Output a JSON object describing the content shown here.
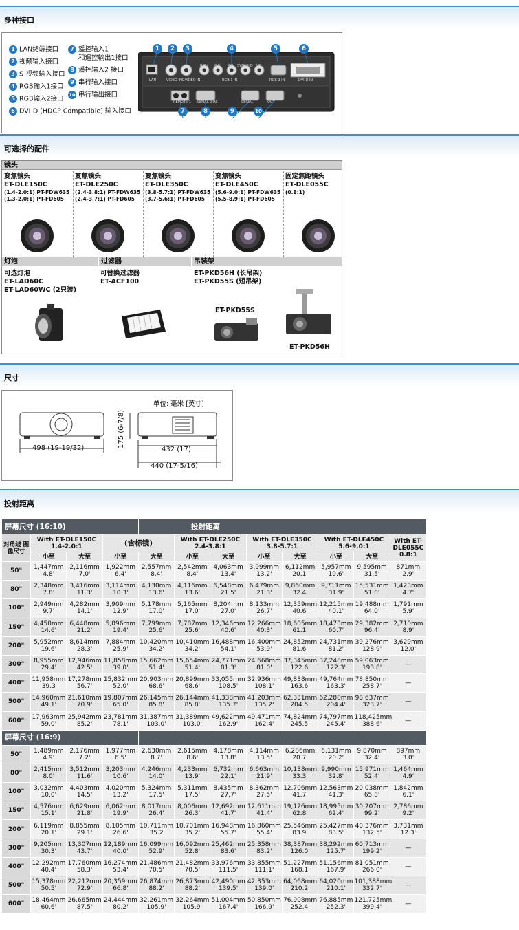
{
  "sections": {
    "ports": "多种接口",
    "accessories": "可选择的配件",
    "dimensions": "尺寸",
    "throw": "投射距离"
  },
  "ports": {
    "left": [
      {
        "n": "1",
        "label": "LAN终端接口"
      },
      {
        "n": "2",
        "label": "视频输入接口"
      },
      {
        "n": "3",
        "label": "S-视频输入接口"
      },
      {
        "n": "4",
        "label": "RGB输入1接口"
      },
      {
        "n": "5",
        "label": "RGB输入2接口"
      },
      {
        "n": "6",
        "label": "DVI-D (HDCP Compatible) 输入接口"
      }
    ],
    "right": [
      {
        "n": "7",
        "label": "遥控输入1",
        "label2": "和遥控输出1接口"
      },
      {
        "n": "8",
        "label": "遥控输入2 接口"
      },
      {
        "n": "9",
        "label": "串行输入接口"
      },
      {
        "n": "10",
        "label": "串行输出接口"
      }
    ],
    "panel_labels": {
      "lan": "LAN",
      "video_in": "VIDEO IN",
      "s_video_in": "S-VIDEO IN",
      "rgb1_in": "RGB 1 IN",
      "rgb2_in": "RGB 2 IN",
      "dvi_d_in": "DVI-D IN",
      "remote1": "REMOTE 1",
      "serial2_in": "SERIAL 2 IN",
      "serial": "SERIAL",
      "out": "OUT",
      "b_pb": "B/Pb",
      "g_y": "G/Y",
      "r_pr": "R/Pr",
      "sync_hd": "SYNC/HD",
      "vd": "VD"
    }
  },
  "accessories": {
    "lens_header": "镜头",
    "lenses": [
      {
        "type": "变焦镜头",
        "model": "ET-DLE150C",
        "l1": "(1.4-2.0:1) PT-FDW635",
        "l2": "(1.3-2.0:1) PT-FD605"
      },
      {
        "type": "变焦镜头",
        "model": "ET-DLE250C",
        "l1": "(2.4-3.8:1) PT-FDW635",
        "l2": "(2.4-3.7:1) PT-FD605"
      },
      {
        "type": "变焦镜头",
        "model": "ET-DLE350C",
        "l1": "(3.8-5.7:1) PT-FDW635",
        "l2": "(3.7-5.6:1) PT-FD605"
      },
      {
        "type": "变焦镜头",
        "model": "ET-DLE450C",
        "l1": "(5.6-9.0:1) PT-FDW635",
        "l2": "(5.5-8.9:1) PT-FD605"
      },
      {
        "type": "固定焦距镜头",
        "model": "ET-DLE055C",
        "l1": "(0.8:1)",
        "l2": ""
      }
    ],
    "lamp": {
      "header": "灯泡",
      "l1": "可选灯泡",
      "l2": "ET-LAD60C",
      "l3": "ET-LAD60WC (2只装)"
    },
    "filter": {
      "header": "过滤器",
      "l1": "可替换过滤器",
      "l2": "ET-ACF100"
    },
    "mount": {
      "header": "吊装架",
      "l1": "ET-PKD56H (长吊架)",
      "l2": "ET-PKD55S (短吊架)",
      "img1": "ET-PKD55S",
      "img2": "ET-PKD56H"
    }
  },
  "dimensions": {
    "unit": "单位: 毫米 [英寸]",
    "width": "498 (19-19/32)",
    "height": "175 (6-7/8)",
    "depth1": "432 (17)",
    "depth2": "440 (17-5/16)"
  },
  "throw": {
    "title_left": "屏幕尺寸 (16:10)",
    "title_right": "投射距离",
    "title_169": "屏幕尺寸 (16:9)",
    "diag_label": "对角线 图像尺寸",
    "lens_headers": [
      {
        "l1": "With ET-DLE150C",
        "l2": "1.4-2.0:1"
      },
      {
        "l1": "(含标镜)",
        "l2": ""
      },
      {
        "l1": "With ET-DLE250C",
        "l2": "2.4-3.8:1"
      },
      {
        "l1": "With ET-DLE350C",
        "l2": "3.8-5.7:1"
      },
      {
        "l1": "With ET-DLE450C",
        "l2": "5.6-9.0:1"
      },
      {
        "l1": "With ET-DLE055C",
        "l2": "0.8:1"
      }
    ],
    "min_label": "小至",
    "max_label": "大至",
    "rows_1610": [
      {
        "size": "50\"",
        "cells": [
          [
            "1,447mm",
            "4.8'"
          ],
          [
            "2,116mm",
            "7.0'"
          ],
          [
            "1,922mm",
            "6.4'"
          ],
          [
            "2,557mm",
            "8.4'"
          ],
          [
            "2,542mm",
            "8.4'"
          ],
          [
            "4,063mm",
            "13.4'"
          ],
          [
            "3,999mm",
            "13.2'"
          ],
          [
            "6,112mm",
            "20.1'"
          ],
          [
            "5,957mm",
            "19.6'"
          ],
          [
            "9,595mm",
            "31.5'"
          ],
          [
            "871mm",
            "2.9'"
          ]
        ]
      },
      {
        "size": "80\"",
        "cells": [
          [
            "2,348mm",
            "7.8'"
          ],
          [
            "3,416mm",
            "11.3'"
          ],
          [
            "3,114mm",
            "10.3'"
          ],
          [
            "4,130mm",
            "13.6'"
          ],
          [
            "4,116mm",
            "13.6'"
          ],
          [
            "6,548mm",
            "21.5'"
          ],
          [
            "6,479mm",
            "21.3'"
          ],
          [
            "9,860mm",
            "32.4'"
          ],
          [
            "9,711mm",
            "31.9'"
          ],
          [
            "15,531mm",
            "51.0'"
          ],
          [
            "1,423mm",
            "4.7'"
          ]
        ]
      },
      {
        "size": "100\"",
        "cells": [
          [
            "2,949mm",
            "9.7'"
          ],
          [
            "4,282mm",
            "14.1'"
          ],
          [
            "3,909mm",
            "12.9'"
          ],
          [
            "5,178mm",
            "17.0'"
          ],
          [
            "5,165mm",
            "17.0'"
          ],
          [
            "8,204mm",
            "27.0'"
          ],
          [
            "8,133mm",
            "26.7'"
          ],
          [
            "12,359mm",
            "40.6'"
          ],
          [
            "12,215mm",
            "40.1'"
          ],
          [
            "19,488mm",
            "64.0'"
          ],
          [
            "1,791mm",
            "5.9'"
          ]
        ]
      },
      {
        "size": "150\"",
        "cells": [
          [
            "4,450mm",
            "14.6'"
          ],
          [
            "6,448mm",
            "21.2'"
          ],
          [
            "5,896mm",
            "19.4'"
          ],
          [
            "7,799mm",
            "25.6'"
          ],
          [
            "7,787mm",
            "25.6'"
          ],
          [
            "12,346mm",
            "40.6'"
          ],
          [
            "12,266mm",
            "40.3'"
          ],
          [
            "18,605mm",
            "61.1'"
          ],
          [
            "18,473mm",
            "60.7'"
          ],
          [
            "29,382mm",
            "96.4'"
          ],
          [
            "2,710mm",
            "8.9'"
          ]
        ]
      },
      {
        "size": "200\"",
        "cells": [
          [
            "5,952mm",
            "19.6'"
          ],
          [
            "8,614mm",
            "28.3'"
          ],
          [
            "7,884mm",
            "25.9'"
          ],
          [
            "10,420mm",
            "34.2'"
          ],
          [
            "10,410mm",
            "34.2'"
          ],
          [
            "16,488mm",
            "54.1'"
          ],
          [
            "16,400mm",
            "53.9'"
          ],
          [
            "24,852mm",
            "81.6'"
          ],
          [
            "24,731mm",
            "81.2'"
          ],
          [
            "39,276mm",
            "128.9'"
          ],
          [
            "3,629mm",
            "12.0'"
          ]
        ]
      },
      {
        "size": "300\"",
        "cells": [
          [
            "8,955mm",
            "29.4'"
          ],
          [
            "12,946mm",
            "42.5'"
          ],
          [
            "11,858mm",
            "39.0'"
          ],
          [
            "15,662mm",
            "51.4'"
          ],
          [
            "15,654mm",
            "51.4'"
          ],
          [
            "24,771mm",
            "81.3'"
          ],
          [
            "24,668mm",
            "81.0'"
          ],
          [
            "37,345mm",
            "122.6'"
          ],
          [
            "37,248mm",
            "122.3'"
          ],
          [
            "59,063mm",
            "193.8'"
          ],
          [
            "—",
            ""
          ]
        ]
      },
      {
        "size": "400\"",
        "cells": [
          [
            "11,958mm",
            "39.3"
          ],
          [
            "17,278mm",
            "56.7'"
          ],
          [
            "15,832mm",
            "52.0'"
          ],
          [
            "20,903mm",
            "68.6'"
          ],
          [
            "20,899mm",
            "68.6'"
          ],
          [
            "33,055mm",
            "108.5'"
          ],
          [
            "32,936mm",
            "108.1'"
          ],
          [
            "49,838mm",
            "163.6'"
          ],
          [
            "49,764mm",
            "163.3'"
          ],
          [
            "78,850mm",
            "258.7'"
          ],
          [
            "—",
            ""
          ]
        ]
      },
      {
        "size": "500\"",
        "cells": [
          [
            "14,960mm",
            "49.1'"
          ],
          [
            "21,610mm",
            "70.9'"
          ],
          [
            "19,807mm",
            "65.0'"
          ],
          [
            "26,145mm",
            "85.8'"
          ],
          [
            "26,144mm",
            "85.8'"
          ],
          [
            "41,338mm",
            "135.7'"
          ],
          [
            "41,203mm",
            "135.2'"
          ],
          [
            "62,331mm",
            "204.5'"
          ],
          [
            "62,280mm",
            "204.4'"
          ],
          [
            "98,637mm",
            "323.7'"
          ],
          [
            "—",
            ""
          ]
        ]
      },
      {
        "size": "600\"",
        "cells": [
          [
            "17,963mm",
            "59.0'"
          ],
          [
            "25,942mm",
            "85.2'"
          ],
          [
            "23,781mm",
            "78.1'"
          ],
          [
            "31,387mm",
            "103.0'"
          ],
          [
            "31,389mm",
            "103.0'"
          ],
          [
            "49,622mm",
            "162.9'"
          ],
          [
            "49,471mm",
            "162.4'"
          ],
          [
            "74,824mm",
            "245.5'"
          ],
          [
            "74,797mm",
            "245.4'"
          ],
          [
            "118,425mm",
            "388.6'"
          ],
          [
            "—",
            ""
          ]
        ]
      }
    ],
    "rows_169": [
      {
        "size": "50\"",
        "cells": [
          [
            "1,489mm",
            "4.9'"
          ],
          [
            "2,176mm",
            "7.2'"
          ],
          [
            "1,977mm",
            "6.5'"
          ],
          [
            "2,630mm",
            "8.7'"
          ],
          [
            "2,615mm",
            "8.6'"
          ],
          [
            "4,178mm",
            "13.8'"
          ],
          [
            "4,114mm",
            "13.5'"
          ],
          [
            "6,286mm",
            "20.7'"
          ],
          [
            "6,131mm",
            "20.2'"
          ],
          [
            "9,870mm",
            "32.4'"
          ],
          [
            "897mm",
            "3.0'"
          ]
        ]
      },
      {
        "size": "80\"",
        "cells": [
          [
            "2,415mm",
            "8.0'"
          ],
          [
            "3,512mm",
            "11.6'"
          ],
          [
            "3,203mm",
            "10.6'"
          ],
          [
            "4,246mm",
            "14.0'"
          ],
          [
            "4,233mm",
            "13.9'"
          ],
          [
            "6,732mm",
            "22.1'"
          ],
          [
            "6,663mm",
            "21.9'"
          ],
          [
            "10,138mm",
            "33.3'"
          ],
          [
            "9,990mm",
            "32.8'"
          ],
          [
            "15,971mm",
            "52.4'"
          ],
          [
            "1,464mm",
            "4.9'"
          ]
        ]
      },
      {
        "size": "100\"",
        "cells": [
          [
            "3,032mm",
            "10.0'"
          ],
          [
            "4,403mm",
            "14.5'"
          ],
          [
            "4,020mm",
            "13.2'"
          ],
          [
            "5,324mm",
            "17.5'"
          ],
          [
            "5,311mm",
            "17.5'"
          ],
          [
            "8,435mm",
            "27.7'"
          ],
          [
            "8,362mm",
            "27.5'"
          ],
          [
            "12,706mm",
            "41.7'"
          ],
          [
            "12,563mm",
            "41.3'"
          ],
          [
            "20,038mm",
            "65.8'"
          ],
          [
            "1,842mm",
            "6.1'"
          ]
        ]
      },
      {
        "size": "150\"",
        "cells": [
          [
            "4,576mm",
            "15.1'"
          ],
          [
            "6,629mm",
            "21.8'"
          ],
          [
            "6,062mm",
            "19.9'"
          ],
          [
            "8,017mm",
            "26.4'"
          ],
          [
            "8,006mm",
            "26.3'"
          ],
          [
            "12,692mm",
            "41.7'"
          ],
          [
            "12,611mm",
            "41.4'"
          ],
          [
            "19,126mm",
            "62.8'"
          ],
          [
            "18,995mm",
            "62.4'"
          ],
          [
            "30,207mm",
            "99.2'"
          ],
          [
            "2,786mm",
            "9.2'"
          ]
        ]
      },
      {
        "size": "200\"",
        "cells": [
          [
            "6,119mm",
            "20.1'"
          ],
          [
            "8,855mm",
            "29.1'"
          ],
          [
            "8,105mm",
            "26.6'"
          ],
          [
            "10,711mm",
            "35.2"
          ],
          [
            "10,701mm",
            "35.2'"
          ],
          [
            "16,948mm",
            "55.7'"
          ],
          [
            "16,860mm",
            "55.4'"
          ],
          [
            "25,546mm",
            "83.9'"
          ],
          [
            "25,427mm",
            "83.5'"
          ],
          [
            "40,376mm",
            "132.5'"
          ],
          [
            "3,731mm",
            "12.3'"
          ]
        ]
      },
      {
        "size": "300\"",
        "cells": [
          [
            "9,205mm",
            "30.3'"
          ],
          [
            "13,307mm",
            "43.7'"
          ],
          [
            "12,189mm",
            "40.0'"
          ],
          [
            "16,099mm",
            "52.9'"
          ],
          [
            "16,092mm",
            "52.8'"
          ],
          [
            "25,462mm",
            "83.6'"
          ],
          [
            "25,358mm",
            "83.2'"
          ],
          [
            "38,387mm",
            "126.0'"
          ],
          [
            "38,292mm",
            "125.7'"
          ],
          [
            "60,713mm",
            "199.2'"
          ],
          [
            "—",
            ""
          ]
        ]
      },
      {
        "size": "400\"",
        "cells": [
          [
            "12,292mm",
            "40.4'"
          ],
          [
            "17,760mm",
            "58.3'"
          ],
          [
            "16,274mm",
            "53.4'"
          ],
          [
            "21,486mm",
            "70.5'"
          ],
          [
            "21,482mm",
            "70.5'"
          ],
          [
            "33,976mm",
            "111.5'"
          ],
          [
            "33,855mm",
            "111.1'"
          ],
          [
            "51,227mm",
            "168.1'"
          ],
          [
            "51,156mm",
            "167.9'"
          ],
          [
            "81,051mm",
            "266.0'"
          ],
          [
            "—",
            ""
          ]
        ]
      },
      {
        "size": "500\"",
        "cells": [
          [
            "15,378mm",
            "50.5'"
          ],
          [
            "22,212mm",
            "72.9'"
          ],
          [
            "20,359mm",
            "66.8'"
          ],
          [
            "26,874mm",
            "88.2'"
          ],
          [
            "26,873mm",
            "88.2'"
          ],
          [
            "42,490mm",
            "139.5'"
          ],
          [
            "42,353mm",
            "139.0'"
          ],
          [
            "64,068mm",
            "210.2'"
          ],
          [
            "64,020mm",
            "210.1'"
          ],
          [
            "101,388mm",
            "332.7'"
          ],
          [
            "—",
            ""
          ]
        ]
      },
      {
        "size": "600\"",
        "cells": [
          [
            "18,464mm",
            "60.6'"
          ],
          [
            "26,665mm",
            "87.5'"
          ],
          [
            "24,444mm",
            "80.2'"
          ],
          [
            "32,261mm",
            "105.9'"
          ],
          [
            "32,264mm",
            "105.9'"
          ],
          [
            "51,004mm",
            "167.4'"
          ],
          [
            "50,850mm",
            "166.9'"
          ],
          [
            "76,908mm",
            "252.4'"
          ],
          [
            "76,885mm",
            "252.3'"
          ],
          [
            "121,725mm",
            "399.4'"
          ],
          [
            "—",
            ""
          ]
        ]
      }
    ]
  }
}
